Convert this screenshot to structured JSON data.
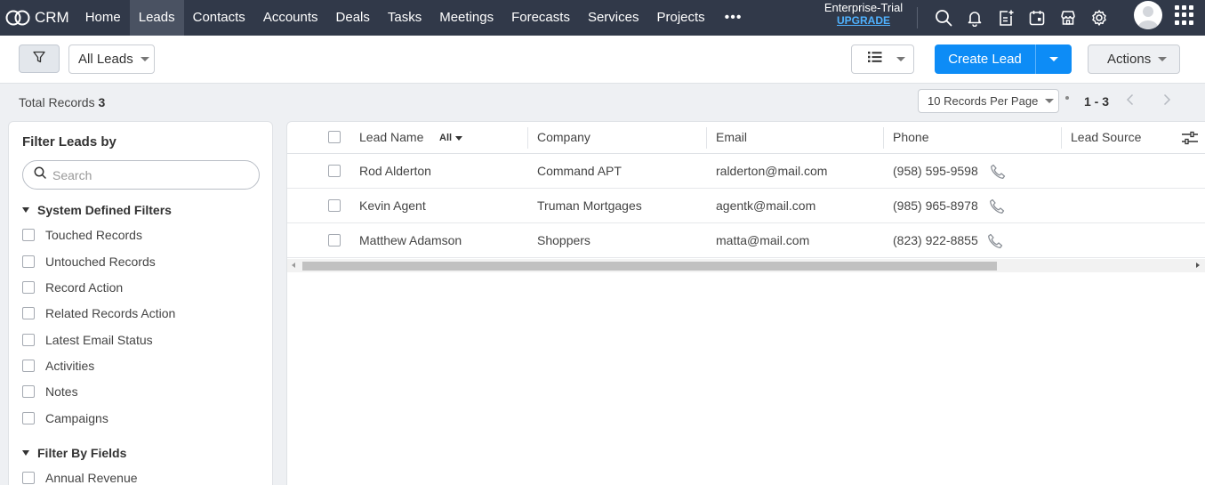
{
  "nav": {
    "brand": "CRM",
    "items": [
      {
        "label": "Home"
      },
      {
        "label": "Leads",
        "active": true
      },
      {
        "label": "Contacts"
      },
      {
        "label": "Accounts"
      },
      {
        "label": "Deals"
      },
      {
        "label": "Tasks"
      },
      {
        "label": "Meetings"
      },
      {
        "label": "Forecasts"
      },
      {
        "label": "Services"
      },
      {
        "label": "Projects"
      }
    ],
    "more": "•••",
    "trial_label": "Enterprise-Trial",
    "upgrade_label": "UPGRADE",
    "icons": [
      "search-icon",
      "bell-icon",
      "add-note-icon",
      "calendar-icon",
      "marketplace-icon",
      "gear-icon"
    ],
    "colors": {
      "bar": "#313949",
      "active": "#4a5262",
      "upgrade": "#4fb2ff"
    }
  },
  "toolbar": {
    "view_label": "All Leads",
    "create_label": "Create Lead",
    "actions_label": "Actions",
    "accent": "#0d8cf6"
  },
  "records": {
    "total_label": "Total Records",
    "total_count": "3",
    "per_page": "10 Records Per Page",
    "range": "1 - 3"
  },
  "filters": {
    "title": "Filter Leads by",
    "search_placeholder": "Search",
    "system_section": "System Defined Filters",
    "system_items": [
      "Touched Records",
      "Untouched Records",
      "Record Action",
      "Related Records Action",
      "Latest Email Status",
      "Activities",
      "Notes",
      "Campaigns"
    ],
    "fields_section": "Filter By Fields",
    "field_items": [
      "Annual Revenue"
    ]
  },
  "table": {
    "columns": {
      "lead_name": "Lead Name",
      "lead_name_filter": "All",
      "company": "Company",
      "email": "Email",
      "phone": "Phone",
      "lead_source": "Lead Source"
    },
    "rows": [
      {
        "name": "Rod Alderton",
        "company": "Command APT",
        "email": "ralderton@mail.com",
        "phone": "(958) 595-9598"
      },
      {
        "name": "Kevin Agent",
        "company": "Truman Mortgages",
        "email": "agentk@mail.com",
        "phone": "(985) 965-8978"
      },
      {
        "name": "Matthew Adamson",
        "company": "Shoppers",
        "email": "matta@mail.com",
        "phone": "(823) 922-8855"
      }
    ]
  }
}
